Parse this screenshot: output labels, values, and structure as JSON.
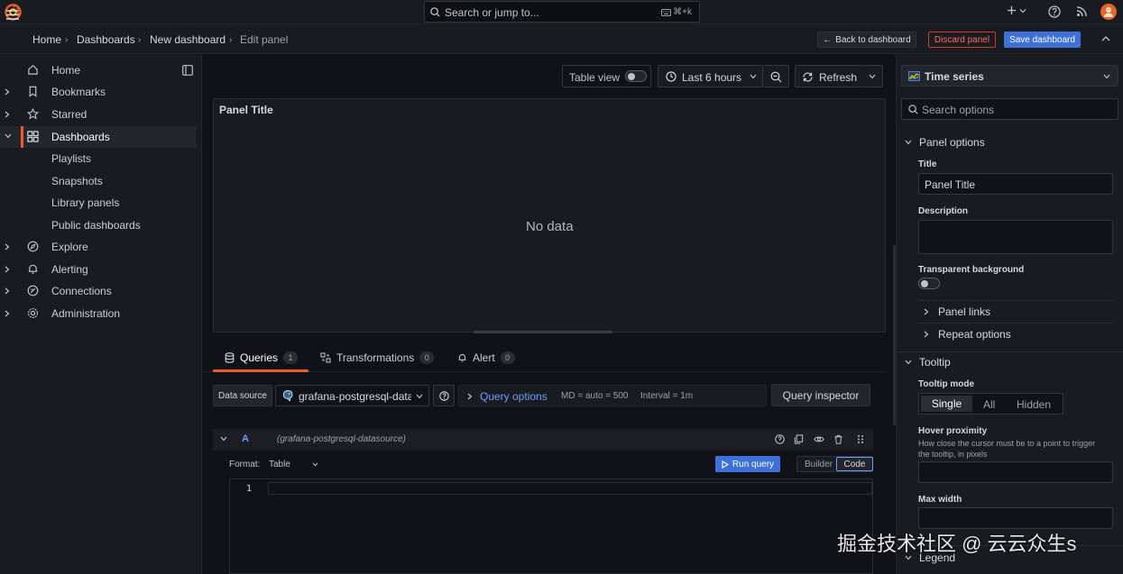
{
  "topbar": {
    "search_placeholder": "Search or jump to...",
    "search_shortcut": "⌘+k"
  },
  "breadcrumb": {
    "home": "Home",
    "dashboards": "Dashboards",
    "new_dashboard": "New dashboard",
    "edit_panel": "Edit panel"
  },
  "actions": {
    "back": "Back to dashboard",
    "discard": "Discard panel",
    "save": "Save dashboard"
  },
  "sidebar": {
    "items": [
      {
        "label": "Home",
        "icon": "home-icon",
        "expandable": false
      },
      {
        "label": "Bookmarks",
        "icon": "bookmark-icon",
        "expandable": true
      },
      {
        "label": "Starred",
        "icon": "star-icon",
        "expandable": true
      },
      {
        "label": "Dashboards",
        "icon": "apps-icon",
        "expandable": true,
        "active": true
      },
      {
        "label": "Explore",
        "icon": "compass-icon",
        "expandable": true
      },
      {
        "label": "Alerting",
        "icon": "bell-icon",
        "expandable": true
      },
      {
        "label": "Connections",
        "icon": "connections-icon",
        "expandable": true
      },
      {
        "label": "Administration",
        "icon": "cog-icon",
        "expandable": true
      }
    ],
    "dashboards_children": [
      "Playlists",
      "Snapshots",
      "Library panels",
      "Public dashboards"
    ]
  },
  "panel_toolbar": {
    "table_view": "Table view",
    "time_range": "Last 6 hours",
    "refresh": "Refresh"
  },
  "panel": {
    "title": "Panel Title",
    "empty": "No data"
  },
  "tabs": [
    {
      "label": "Queries",
      "count": "1",
      "active": true
    },
    {
      "label": "Transformations",
      "count": "0"
    },
    {
      "label": "Alert",
      "count": "0"
    }
  ],
  "query_editor": {
    "datasource_label": "Data source",
    "datasource": "grafana-postgresql-datasource",
    "query_options": "Query options",
    "md": "MD = auto = 500",
    "interval": "Interval = 1m",
    "inspector": "Query inspector",
    "query_letter": "A",
    "query_ds": "(grafana-postgresql-datasource)",
    "format_label": "Format:",
    "format_value": "Table",
    "run_query": "Run query",
    "builder": "Builder",
    "code": "Code",
    "line_number": "1"
  },
  "options": {
    "visualization": "Time series",
    "search_placeholder": "Search options",
    "panel_options": "Panel options",
    "title_label": "Title",
    "title_value": "Panel Title",
    "description_label": "Description",
    "transparent_label": "Transparent background",
    "panel_links": "Panel links",
    "repeat_options": "Repeat options",
    "tooltip": "Tooltip",
    "tooltip_mode_label": "Tooltip mode",
    "tooltip_modes": [
      "Single",
      "All",
      "Hidden"
    ],
    "hover_label": "Hover proximity",
    "hover_desc": "How close the cursor must be to a point to trigger the tooltip, in pixels",
    "max_width_label": "Max width",
    "legend": "Legend"
  },
  "watermark": "掘金技术社区 @ 云云众生s",
  "colors": {
    "accent": "#f05a28",
    "primary": "#3d71d9",
    "link": "#6e9fff",
    "danger": "#d13a25"
  }
}
